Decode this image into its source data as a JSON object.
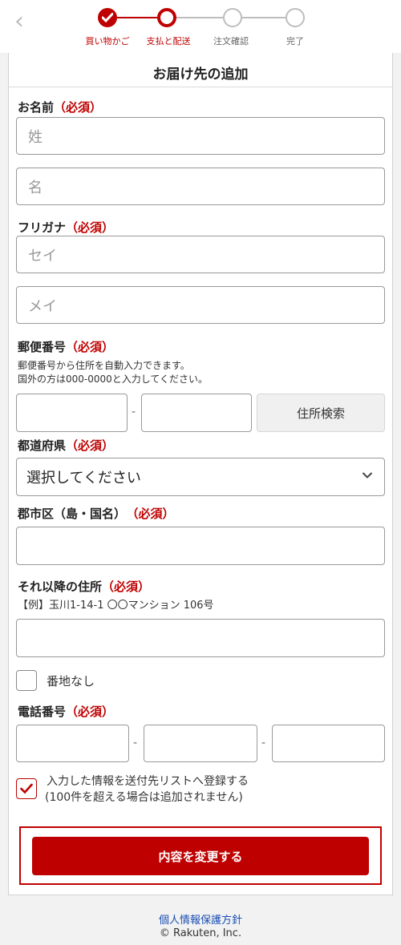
{
  "steps": [
    {
      "label": "買い物かご",
      "state": "done"
    },
    {
      "label": "支払と配送",
      "state": "current"
    },
    {
      "label": "注文確認",
      "state": "todo"
    },
    {
      "label": "完了",
      "state": "todo"
    }
  ],
  "colors": {
    "accent": "#bf0000",
    "inactive": "#bdbdbd",
    "link": "#1a4fb3"
  },
  "page_title": "お届け先の追加",
  "required_mark": "（必須）",
  "name": {
    "label": "お名前",
    "last_placeholder": "姓",
    "first_placeholder": "名"
  },
  "kana": {
    "label": "フリガナ",
    "last_placeholder": "セイ",
    "first_placeholder": "メイ"
  },
  "postal": {
    "label": "郵便番号",
    "note_line1": "郵便番号から住所を自動入力できます。",
    "note_line2": "国外の方は000-0000と入力してください。",
    "separator": "-",
    "search_button": "住所検索"
  },
  "prefecture": {
    "label": "都道府県",
    "selected": "選択してください"
  },
  "city": {
    "label": "郡市区（島・国名）",
    "required": "（必須）"
  },
  "street": {
    "label": "それ以降の住所",
    "example": "【例】玉川1-14-1 〇〇マンション 106号"
  },
  "no_banchi": {
    "label": "番地なし",
    "checked": false
  },
  "phone": {
    "label": "電話番号",
    "separator": "-"
  },
  "register": {
    "line1": "入力した情報を送付先リストへ登録する",
    "line2": "(100件を超える場合は追加されません)",
    "checked": true
  },
  "submit_label": "内容を変更する",
  "footer": {
    "privacy_link": "個人情報保護方針",
    "copyright": "© Rakuten, Inc."
  }
}
